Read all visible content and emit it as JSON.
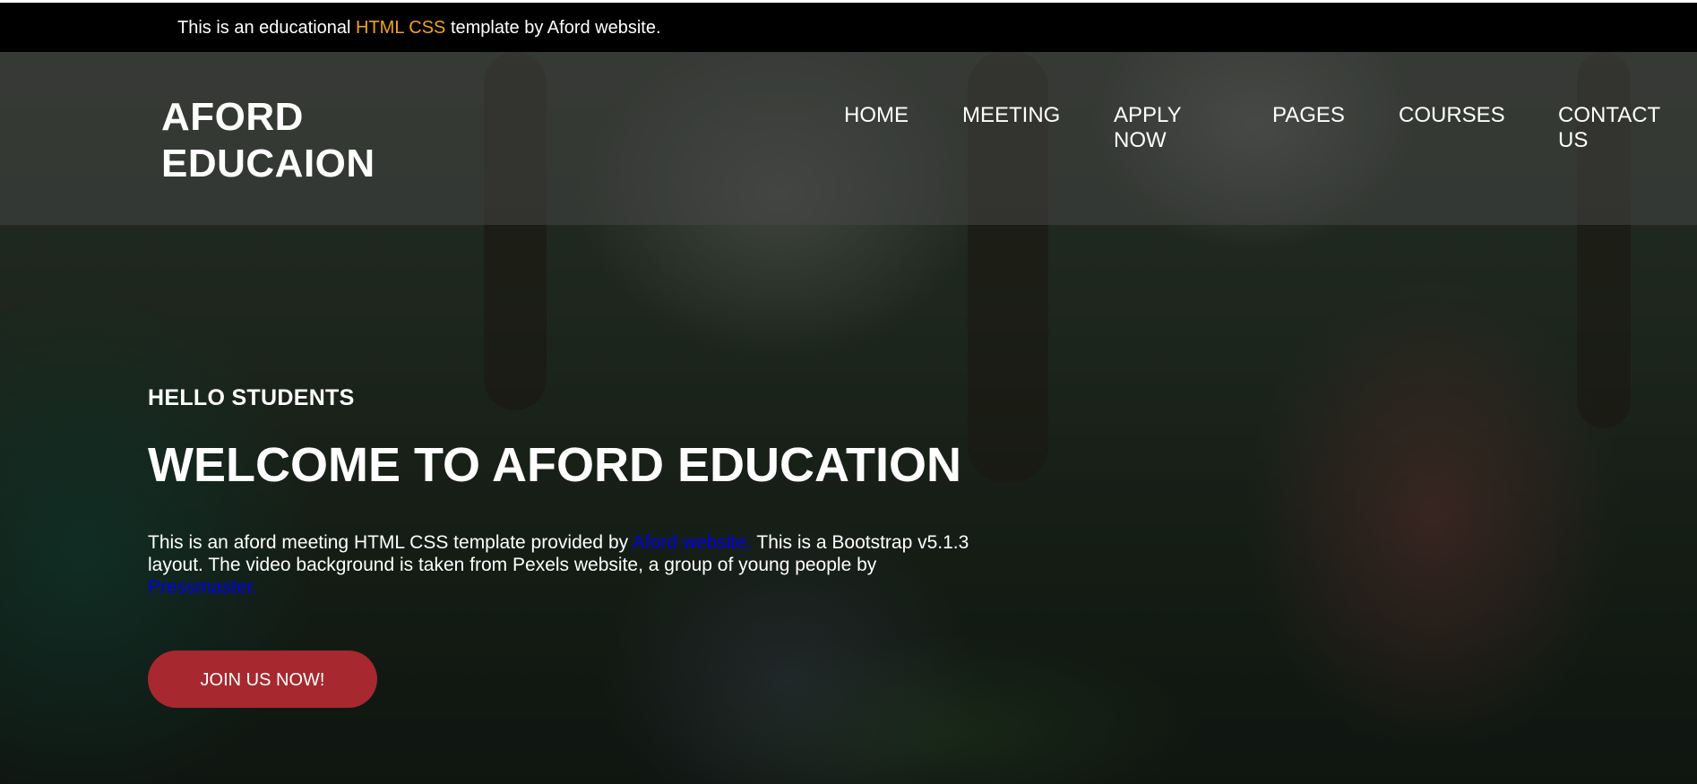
{
  "topbar": {
    "text_before": "This is an educational",
    "highlight": "HTML CSS",
    "text_after": "template by Aford website.",
    "highlight_color": "#f4a11c"
  },
  "navbar": {
    "brand_line1": "AFORD",
    "brand_line2": "EDUCAION",
    "items": [
      {
        "label": "HOME"
      },
      {
        "label": "MEETING"
      },
      {
        "label": "APPLY NOW"
      },
      {
        "label": "PAGES"
      },
      {
        "label": "COURSES"
      },
      {
        "label": "CONTACT US"
      }
    ]
  },
  "hero": {
    "greeting": "HELLO STUDENTS",
    "headline": "WELCOME TO AFORD EDUCATION",
    "description": {
      "part1": "This is an aford meeting HTML CSS template provided by",
      "link1": "Aford website.",
      "part2": "This is a Bootstrap v5.1.3 layout. The video background is taken from Pexels website, a group of young people by",
      "link2": "Pressmaster."
    },
    "cta_label": "JOIN US NOW!",
    "cta_color": "#a7282e"
  }
}
